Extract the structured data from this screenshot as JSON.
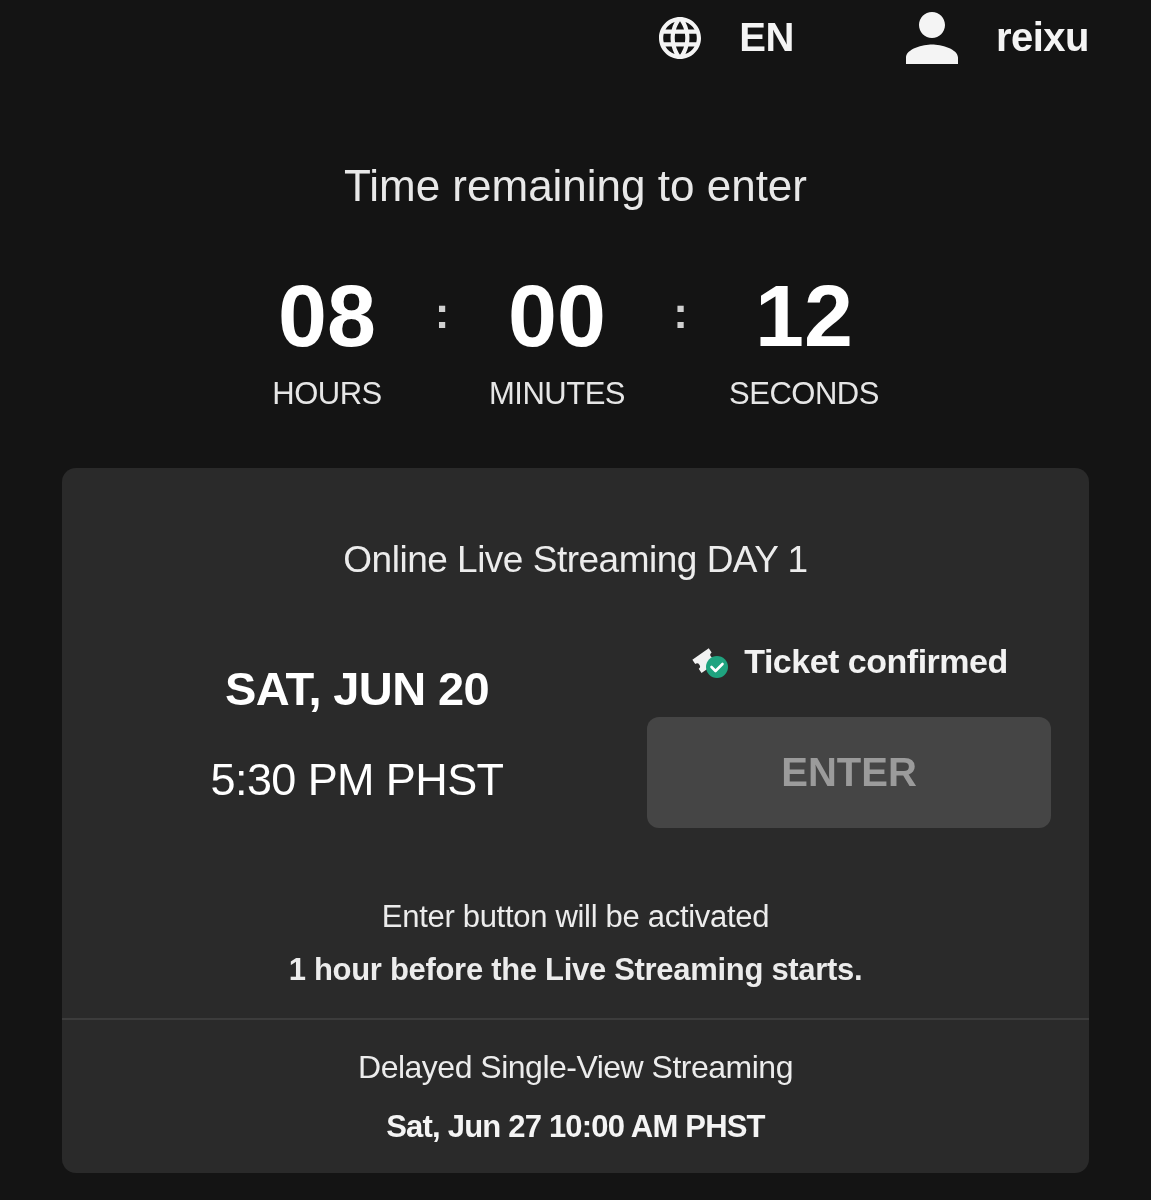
{
  "header": {
    "language": "EN",
    "username": "reixu"
  },
  "countdown": {
    "title": "Time remaining to enter",
    "units": [
      {
        "value": "08",
        "label": "HOURS"
      },
      {
        "value": "00",
        "label": "MINUTES"
      },
      {
        "value": "12",
        "label": "SECONDS"
      }
    ],
    "separators": [
      ":",
      ":"
    ]
  },
  "event": {
    "title": "Online Live Streaming DAY 1",
    "date": "SAT, JUN 20",
    "time": "5:30 PM PHST",
    "ticket_status": "Ticket confirmed",
    "enter_button": {
      "label": "ENTER",
      "disabled": true
    },
    "notice": "Enter button will be activated\n**1 hour before the Live Streaming starts.**",
    "delayed": {
      "title": "Delayed Single-View Streaming",
      "schedule": "Sat, Jun 27 10:00 AM PHST"
    }
  }
}
